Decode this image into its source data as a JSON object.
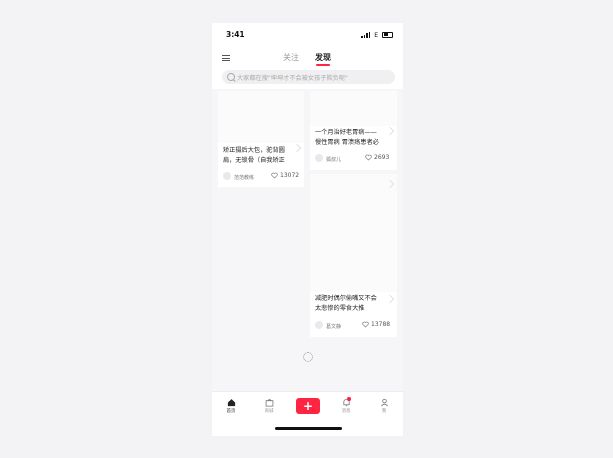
{
  "status_bar": {
    "time": "3:41",
    "carrier": "E"
  },
  "nav": {
    "tabs": [
      "关注",
      "发现"
    ],
    "active_tab": "发现"
  },
  "search": {
    "placeholder": "大家都在搜\"坤坤才不会被女孩子欺负呢\""
  },
  "feed": {
    "cards": [
      {
        "title_line1": "矫正摄后大包，驼背圆",
        "title_line2": "肩，无锁骨（自我矫正",
        "author": "范范教练",
        "likes": "13072"
      },
      {
        "title_line1": "一个月治好老胃病——",
        "title_line2": "慢性胃病 胃溃疡患者必",
        "author": "狐叔儿",
        "likes": "2693"
      },
      {
        "title_line1": "减肥时偶尔偷嘴又不会",
        "title_line2": "太悲惨的零食大推",
        "author": "葛文静",
        "likes": "13788"
      }
    ]
  },
  "tab_bar": {
    "home_label": "首页",
    "shop_label": "商城",
    "add_label": "+",
    "message_label": "消息",
    "me_label": "我"
  },
  "colors": {
    "accent": "#ff2442",
    "background": "#f6f6f8"
  },
  "icons": [
    "menu-icon",
    "search-icon",
    "heart-icon",
    "home-icon",
    "shop-icon",
    "bell-icon",
    "user-icon",
    "loading-spinner"
  ]
}
